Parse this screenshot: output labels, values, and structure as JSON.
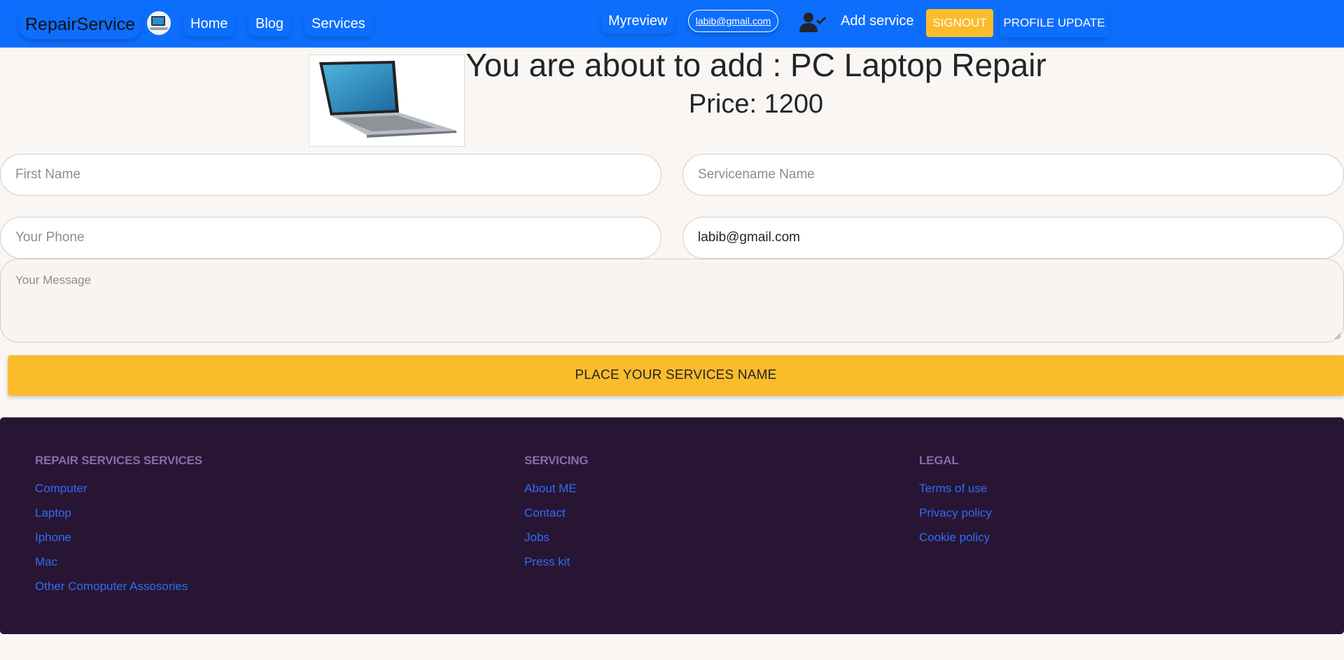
{
  "navbar": {
    "brand": "RepairService",
    "links": {
      "home": "Home",
      "blog": "Blog",
      "services": "Services"
    },
    "myreview": "Myreview",
    "user_email": "labib@gmail.com",
    "add_service": "Add service",
    "signout": "SIGNOUT",
    "profile_update": "PROFILE UPDATE"
  },
  "header": {
    "title": "You are about to add : PC Laptop Repair",
    "price": "Price: 1200"
  },
  "form": {
    "first_name": {
      "placeholder": "First Name",
      "value": ""
    },
    "service_name": {
      "placeholder": "Servicename Name",
      "value": ""
    },
    "phone": {
      "placeholder": "Your Phone",
      "value": ""
    },
    "email": {
      "placeholder": "",
      "value": "labib@gmail.com"
    },
    "message": {
      "placeholder": "Your Message",
      "value": ""
    },
    "submit": "PLACE YOUR SERVICES NAME"
  },
  "footer": {
    "columns": [
      {
        "heading": "REPAIR SERVICES SERVICES",
        "links": [
          "Computer",
          "Laptop",
          "Iphone",
          "Mac",
          "Other Comoputer Assosories"
        ]
      },
      {
        "heading": "SERVICING",
        "links": [
          "About ME",
          "Contact",
          "Jobs",
          "Press kit"
        ]
      },
      {
        "heading": "LEGAL",
        "links": [
          "Terms of use",
          "Privacy policy",
          "Cookie policy"
        ]
      }
    ]
  },
  "colors": {
    "navbar": "#0d6efd",
    "accent": "#fbbc2c",
    "footer": "#281534",
    "footer_heading": "#8b6ba8",
    "footer_link": "#2f6df0"
  },
  "icons": [
    "laptop-logo-icon",
    "user-check-icon",
    "laptop-thumbnail"
  ]
}
